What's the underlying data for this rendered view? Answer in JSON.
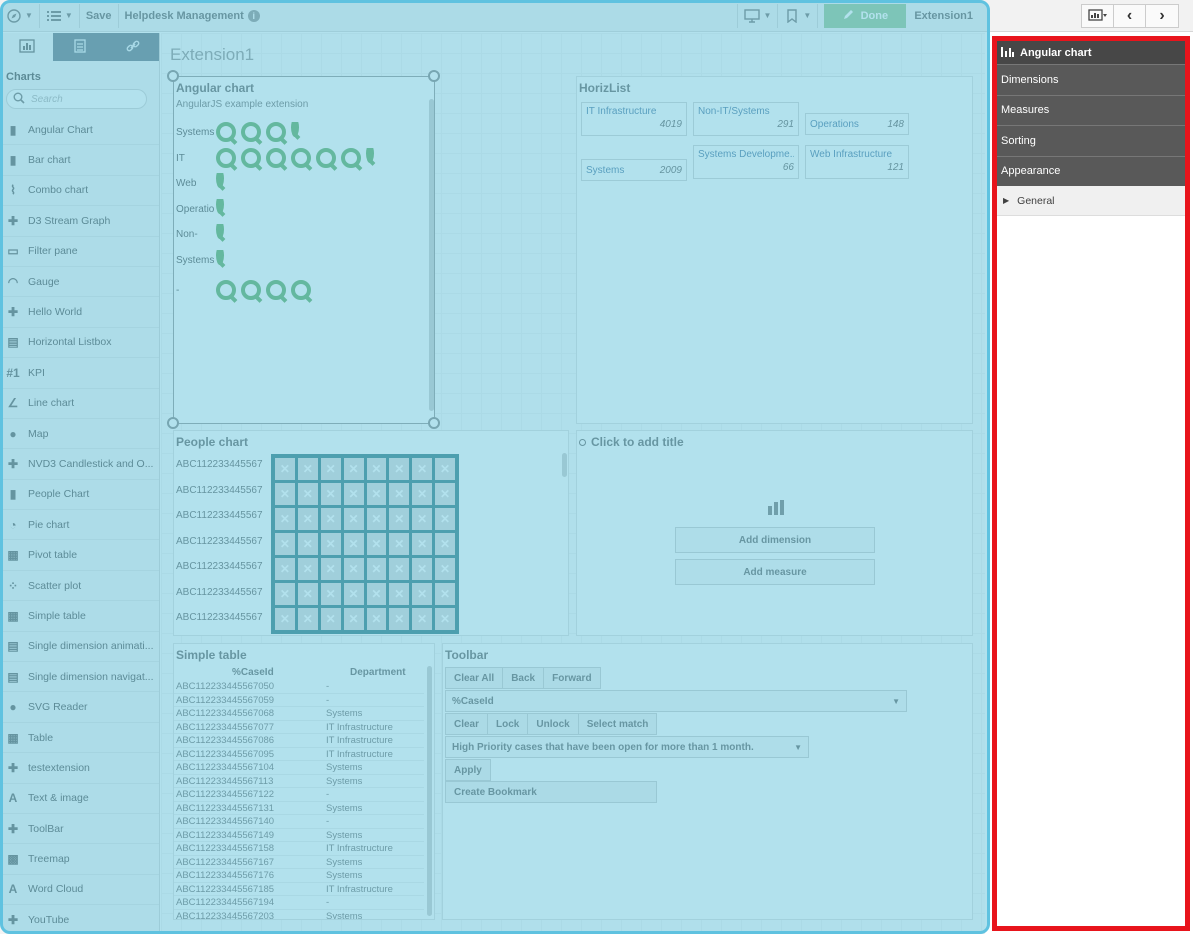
{
  "toolbar": {
    "save_label": "Save",
    "app_name": "Helpdesk Management",
    "done_label": "Done",
    "sheet_label": "Extension1"
  },
  "left_panel": {
    "title": "Charts",
    "search_placeholder": "Search",
    "items": [
      {
        "label": "Angular Chart",
        "icon": "bar-chart-icon"
      },
      {
        "label": "Bar chart",
        "icon": "bar-chart-icon"
      },
      {
        "label": "Combo chart",
        "icon": "combo-chart-icon"
      },
      {
        "label": "D3 Stream Graph",
        "icon": "puzzle-icon"
      },
      {
        "label": "Filter pane",
        "icon": "filter-pane-icon"
      },
      {
        "label": "Gauge",
        "icon": "gauge-icon"
      },
      {
        "label": "Hello World",
        "icon": "puzzle-icon"
      },
      {
        "label": "Horizontal Listbox",
        "icon": "listbox-icon"
      },
      {
        "label": "KPI",
        "icon": "kpi-icon"
      },
      {
        "label": "Line chart",
        "icon": "line-chart-icon"
      },
      {
        "label": "Map",
        "icon": "globe-icon"
      },
      {
        "label": "NVD3 Candlestick and O...",
        "icon": "puzzle-icon"
      },
      {
        "label": "People Chart",
        "icon": "bar-chart-icon"
      },
      {
        "label": "Pie chart",
        "icon": "pie-chart-icon"
      },
      {
        "label": "Pivot table",
        "icon": "pivot-table-icon"
      },
      {
        "label": "Scatter plot",
        "icon": "scatter-plot-icon"
      },
      {
        "label": "Simple table",
        "icon": "table-icon"
      },
      {
        "label": "Single dimension animati...",
        "icon": "listbox-icon"
      },
      {
        "label": "Single dimension navigat...",
        "icon": "listbox-icon"
      },
      {
        "label": "SVG Reader",
        "icon": "globe-icon"
      },
      {
        "label": "Table",
        "icon": "table-icon"
      },
      {
        "label": "testextension",
        "icon": "puzzle-icon"
      },
      {
        "label": "Text & image",
        "icon": "text-image-icon"
      },
      {
        "label": "ToolBar",
        "icon": "puzzle-icon"
      },
      {
        "label": "Treemap",
        "icon": "treemap-icon"
      },
      {
        "label": "Word Cloud",
        "icon": "text-image-icon"
      },
      {
        "label": "YouTube",
        "icon": "puzzle-icon"
      }
    ]
  },
  "sheet": {
    "title": "Extension1",
    "angular": {
      "title": "Angular chart",
      "subtitle": "AngularJS example extension",
      "rows": [
        {
          "label": "Systems",
          "full": 3,
          "half": true
        },
        {
          "label": "IT",
          "full": 6,
          "half": true
        },
        {
          "label": "Web",
          "full": 0,
          "half": true
        },
        {
          "label": "Operatio",
          "full": 0,
          "half": true
        },
        {
          "label": "Non-",
          "full": 0,
          "half": true
        },
        {
          "label": "Systems",
          "full": 0,
          "half": true
        },
        {
          "label": "-",
          "full": 4,
          "half": false
        }
      ]
    },
    "horizlist": {
      "title": "HorizList",
      "items": [
        {
          "name": "IT Infrastructure",
          "value": "4019"
        },
        {
          "name": "Non-IT/Systems",
          "value": "291"
        },
        {
          "name": "Operations",
          "value": "148"
        },
        {
          "name": "Systems",
          "value": "2009"
        },
        {
          "name": "Systems Developme...",
          "value": "66"
        },
        {
          "name": "Web Infrastructure",
          "value": "121"
        }
      ]
    },
    "people": {
      "title": "People chart",
      "rows": [
        "ABC112233445567",
        "ABC112233445567",
        "ABC112233445567",
        "ABC112233445567",
        "ABC112233445567",
        "ABC112233445567",
        "ABC112233445567"
      ],
      "img_label": "DBS"
    },
    "empty_chart": {
      "title": "Click to add title",
      "add_dimension": "Add dimension",
      "add_measure": "Add measure"
    },
    "simple_table": {
      "title": "Simple table",
      "headers": [
        "%CaseId",
        "Department"
      ],
      "rows": [
        [
          "ABC112233445567050",
          "-"
        ],
        [
          "ABC112233445567059",
          "-"
        ],
        [
          "ABC112233445567068",
          "Systems"
        ],
        [
          "ABC112233445567077",
          "IT Infrastructure"
        ],
        [
          "ABC112233445567086",
          "IT Infrastructure"
        ],
        [
          "ABC112233445567095",
          "IT Infrastructure"
        ],
        [
          "ABC112233445567104",
          "Systems"
        ],
        [
          "ABC112233445567113",
          "Systems"
        ],
        [
          "ABC112233445567122",
          "-"
        ],
        [
          "ABC112233445567131",
          "Systems"
        ],
        [
          "ABC112233445567140",
          "-"
        ],
        [
          "ABC112233445567149",
          "Systems"
        ],
        [
          "ABC112233445567158",
          "IT Infrastructure"
        ],
        [
          "ABC112233445567167",
          "Systems"
        ],
        [
          "ABC112233445567176",
          "Systems"
        ],
        [
          "ABC112233445567185",
          "IT Infrastructure"
        ],
        [
          "ABC112233445567194",
          "-"
        ],
        [
          "ABC112233445567203",
          "Systems"
        ]
      ]
    },
    "toolbar_ext": {
      "title": "Toolbar",
      "nav_buttons": [
        "Clear All",
        "Back",
        "Forward"
      ],
      "field_select": "%CaseId",
      "field_buttons": [
        "Clear",
        "Lock",
        "Unlock",
        "Select match"
      ],
      "bookmark_select": "High Priority cases that have been open for more than 1 month.",
      "apply_label": "Apply",
      "create_bookmark_label": "Create Bookmark"
    }
  },
  "properties": {
    "header": "Angular chart",
    "sections": [
      "Dimensions",
      "Measures",
      "Sorting",
      "Appearance"
    ],
    "subsection": "General"
  },
  "colors": {
    "overlay": "#72c8de",
    "highlight_border": "#e8141c",
    "qlik_green": "#52a552",
    "done_green": "#8ac18a"
  }
}
